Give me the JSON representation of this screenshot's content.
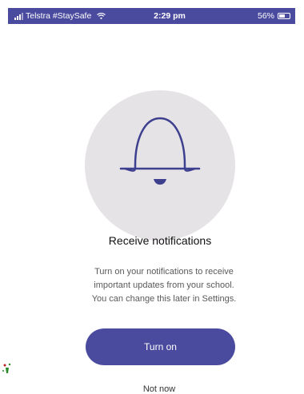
{
  "status_bar": {
    "carrier": "Telstra #StaySafe",
    "time": "2:29 pm",
    "battery": "56%",
    "signal_icon": "signal-icon",
    "wifi_icon": "wifi-icon",
    "battery_icon": "battery-icon",
    "battery_level": 0.56
  },
  "hero": {
    "icon": "bell-icon",
    "circle_color": "#e6e3e6",
    "icon_color": "#3d3f8f"
  },
  "content": {
    "title": "Receive notifications",
    "body_lines": [
      "Turn on your notifications to receive",
      "important updates from your school.",
      "You can change this later in Settings."
    ]
  },
  "actions": {
    "turn_on_label": "Turn on",
    "not_now_label": "Not now"
  },
  "colors": {
    "accent": "#4a4b9e",
    "background": "#ffffff"
  }
}
